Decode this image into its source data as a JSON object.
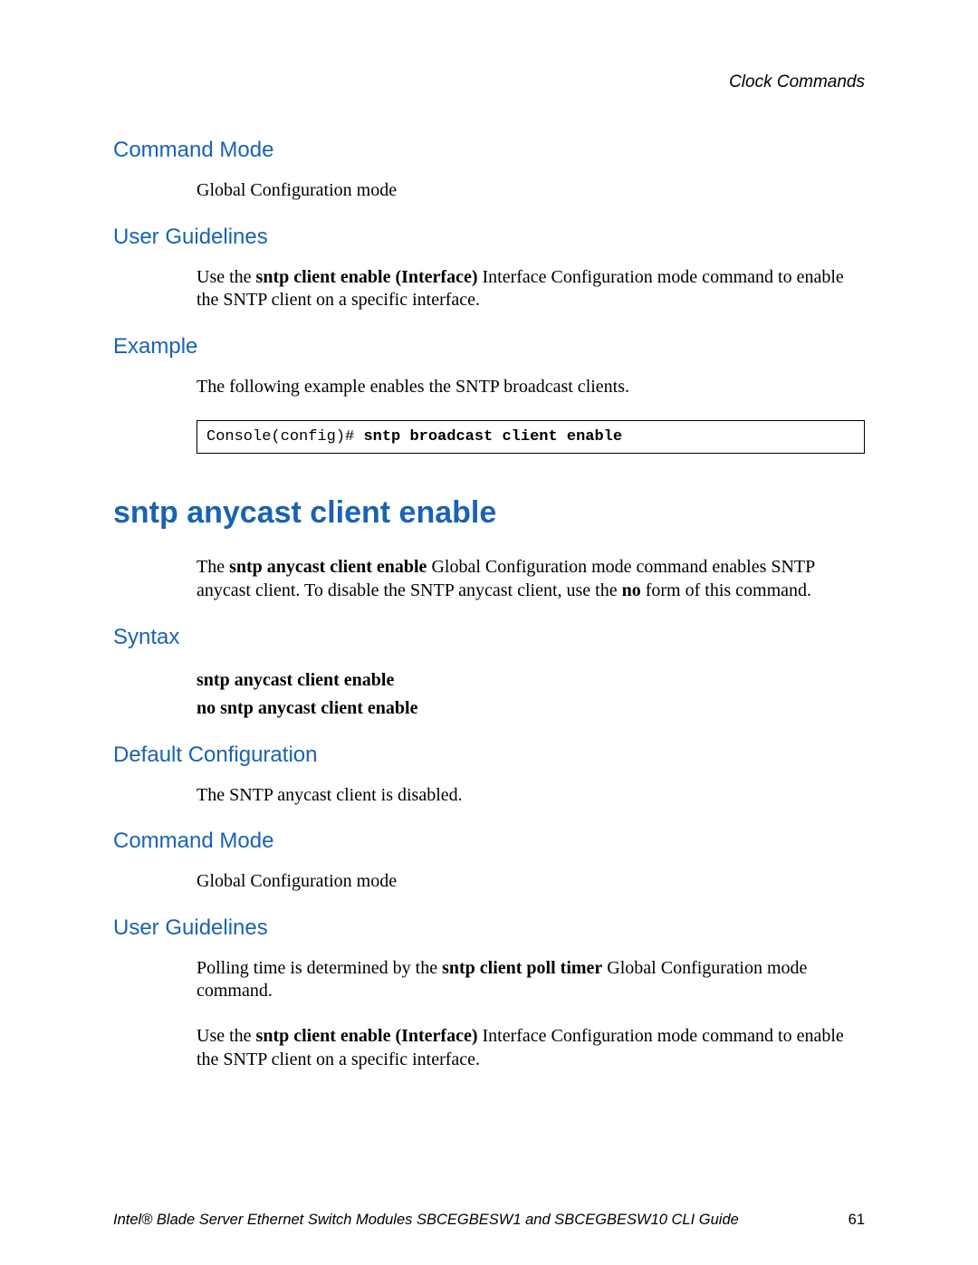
{
  "header": {
    "right": "Clock Commands"
  },
  "sec1": {
    "heading": "Command Mode",
    "body": "Global Configuration mode"
  },
  "sec2": {
    "heading": "User Guidelines",
    "body_pre": "Use the ",
    "body_bold": "sntp client enable (Interface)",
    "body_post": " Interface Configuration mode command to enable the SNTP client on a specific interface."
  },
  "sec3": {
    "heading": "Example",
    "body": "The following example enables the SNTP broadcast clients.",
    "code_plain": "Console(config)# ",
    "code_bold": "sntp broadcast client enable"
  },
  "main": {
    "title": "sntp anycast client enable",
    "intro_pre": "The ",
    "intro_b1": "sntp anycast client enable",
    "intro_mid": " Global Configuration mode command enables SNTP anycast client. To disable the SNTP anycast client, use the ",
    "intro_b2": "no",
    "intro_post": " form of this command."
  },
  "sec4": {
    "heading": "Syntax",
    "line1": "sntp anycast client enable",
    "line2": "no sntp anycast client enable"
  },
  "sec5": {
    "heading": "Default Configuration",
    "body": "The SNTP anycast client is disabled."
  },
  "sec6": {
    "heading": "Command Mode",
    "body": "Global Configuration mode"
  },
  "sec7": {
    "heading": "User Guidelines",
    "p1_pre": "Polling time is determined by the ",
    "p1_bold": "sntp client poll timer",
    "p1_post": " Global Configuration mode command.",
    "p2_pre": "Use the ",
    "p2_bold": "sntp client enable (Interface)",
    "p2_post": " Interface Configuration mode command to enable the SNTP client on a specific interface."
  },
  "footer": {
    "left": "Intel® Blade Server Ethernet Switch Modules SBCEGBESW1 and SBCEGBESW10 CLI Guide",
    "right": "61"
  }
}
